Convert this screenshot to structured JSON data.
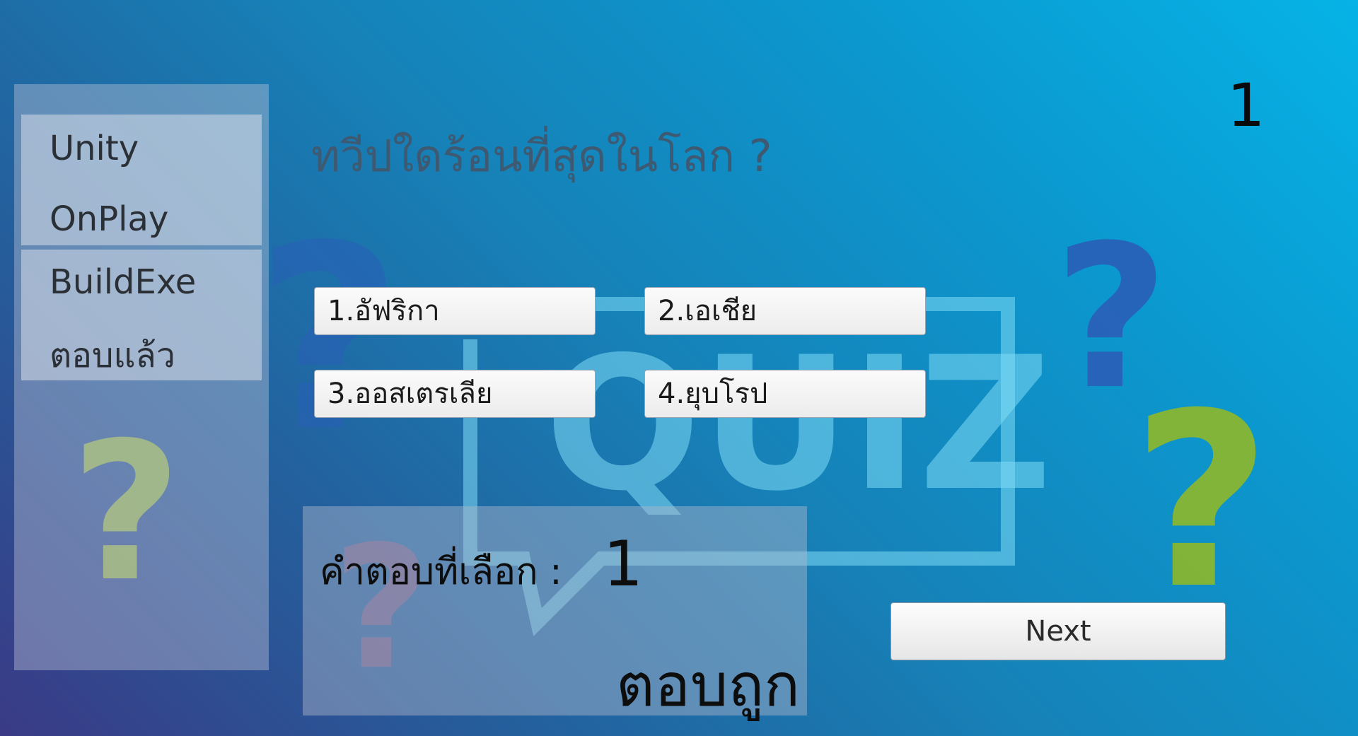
{
  "sidebar": {
    "labels": [
      "Unity",
      "OnPlay",
      "BuildExe",
      "ตอบแล้ว"
    ]
  },
  "question": {
    "text": "ทวีปใดร้อนที่สุดในโลก ?",
    "number": "1"
  },
  "answers": [
    {
      "label": "1.อัฟริกา"
    },
    {
      "label": "2.เอเชีย"
    },
    {
      "label": "3.ออสเตรเลีย"
    },
    {
      "label": "4.ยุบโรป"
    }
  ],
  "result": {
    "selected_label": "คำตอบที่เลือก :",
    "selected_value": "1",
    "result_text": "ตอบถูก"
  },
  "next_button": {
    "label": "Next"
  },
  "background": {
    "watermark_text": "QUIZ",
    "icons": [
      "question-mark-icon"
    ],
    "colors": {
      "gradient_top_right": "#06b3e6",
      "gradient_bottom_left": "#3a3a86",
      "watermark": "#7fdcf6",
      "question_blue": "#2a5fb8",
      "question_green": "#8fb82a",
      "question_pink": "#b85a7a"
    }
  }
}
